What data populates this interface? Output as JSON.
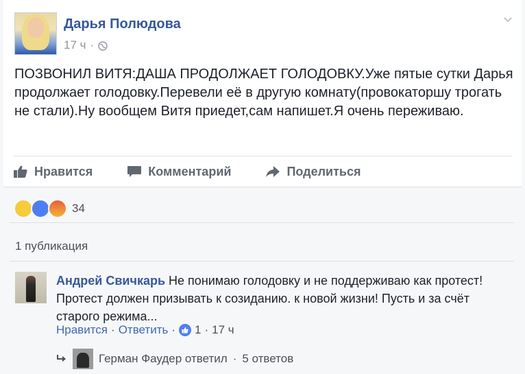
{
  "post": {
    "author": "Дарья Полюдова",
    "time": "17 ч",
    "separator": "·",
    "text": "ПОЗВОНИЛ ВИТЯ:ДАША ПРОДОЛЖАЕТ ГОЛОДОВКУ.Уже пятые сутки Дарья продолжает голодовку.Перевели её в другую комнату(провокаторшу трогать не стали).Ну вообщем Витя приедет,сам напишет.Я очень переживаю.",
    "icons": {
      "audience": "globe-icon",
      "menu": "chevron-down-icon"
    }
  },
  "actions": {
    "like_label": "Нравится",
    "comment_label": "Комментарий",
    "share_label": "Поделиться"
  },
  "reactions": {
    "count": "34",
    "types": [
      "sad",
      "like",
      "angry"
    ]
  },
  "shares": {
    "label": "1 публикация"
  },
  "comment": {
    "author": "Андрей Свичкарь",
    "text": "Не понимаю голодовку и не поддерживаю как протест! Протест должен призывать к созиданию. к новой жизни! Пусть и за счёт старого режима...",
    "like_label": "Нравится",
    "reply_label": "Ответить",
    "like_count": "1",
    "time": "17 ч",
    "separator": "·"
  },
  "replies": {
    "text": "Герман Фаудер ответил",
    "separator": "·",
    "count_label": "5 ответов"
  },
  "colors": {
    "link": "#365899",
    "muted": "#90949c",
    "like_blue": "#4e7ff2"
  }
}
